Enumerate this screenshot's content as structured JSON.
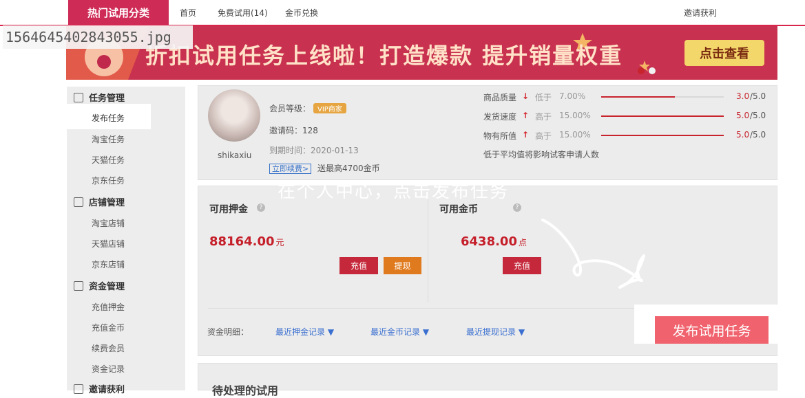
{
  "filename": "1564645402843055.jpg",
  "nav": {
    "hot": "热门试用分类",
    "home": "首页",
    "free_trial": "免费试用(14)",
    "gold_exchange": "金币兑换",
    "invite": "邀请获利"
  },
  "banner": {
    "title": "折扣试用任务上线啦！打造爆款 提升销量权重",
    "button": "点击查看"
  },
  "sidebar": {
    "groups": [
      {
        "title": "任务管理",
        "items": [
          "发布任务",
          "淘宝任务",
          "天猫任务",
          "京东任务"
        ]
      },
      {
        "title": "店铺管理",
        "items": [
          "淘宝店铺",
          "天猫店铺",
          "京东店铺"
        ]
      },
      {
        "title": "资金管理",
        "items": [
          "充值押金",
          "充值金币",
          "续费会员",
          "资金记录"
        ]
      },
      {
        "title": "邀请获利",
        "items": []
      }
    ]
  },
  "profile": {
    "username": "shikaxiu",
    "level_label": "会员等级：",
    "vip_badge": "VIP商家",
    "invite_code": "邀请码：128",
    "expire": "到期时间：2020-01-13",
    "renew": "立即续费>",
    "bonus": "送最高4700金币"
  },
  "scores": [
    {
      "label": "商品质量",
      "trend": "↓",
      "compare": "低于",
      "pct": "7.00%",
      "score": "3.0",
      "total": "/5.0",
      "fill": 0.6
    },
    {
      "label": "发货速度",
      "trend": "↑",
      "compare": "高于",
      "pct": "15.00%",
      "score": "5.0",
      "total": "/5.0",
      "fill": 1.0
    },
    {
      "label": "物有所值",
      "trend": "↑",
      "compare": "高于",
      "pct": "15.00%",
      "score": "5.0",
      "total": "/5.0",
      "fill": 1.0
    }
  ],
  "score_note": "低于平均值将影响试客申请人数",
  "funds": {
    "deposit_label": "可用押金",
    "deposit_value": "88164.00",
    "deposit_unit": "元",
    "recharge": "充值",
    "withdraw": "提现",
    "gold_label": "可用金币",
    "gold_value": "6438.00",
    "gold_unit": "点",
    "gold_recharge": "充值",
    "detail_label": "资金明细：",
    "link_deposit": "最近押金记录 ▼",
    "link_gold": "最近金币记录 ▼",
    "link_withdraw": "最近提现记录 ▼"
  },
  "pending_title": "待处理的试用",
  "caption": "在个人中心，点击发布任务",
  "publish_button": "发布试用任务",
  "colors": {
    "brand": "#cf2b57",
    "publish": "#f0626d",
    "price": "#c51f2a",
    "withdraw": "#e07a1e"
  }
}
